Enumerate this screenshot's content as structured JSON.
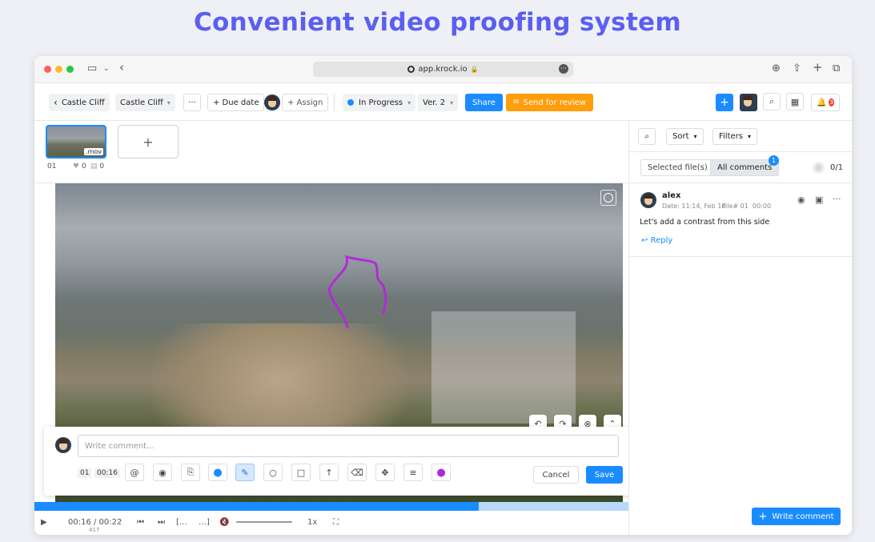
{
  "headline": "Convenient video proofing system",
  "browser": {
    "url": "app.krock.io"
  },
  "toolbar": {
    "back_label": "Castle Cliff",
    "project_label": "Castle Cliff",
    "more": "···",
    "due_date": "+ Due date",
    "assign": "+ Assign",
    "status": "In Progress",
    "version": "Ver. 2",
    "share": "Share",
    "send_review": "Send for review",
    "plus": "+",
    "notifications": "3"
  },
  "thumbs": {
    "ext": ".mov",
    "index": "01",
    "likes": "0",
    "comments": "0",
    "add": "+"
  },
  "composer": {
    "placeholder": "Write comment...",
    "frame": "01",
    "time": "00:16",
    "cancel": "Cancel",
    "save": "Save"
  },
  "player": {
    "time": "00:16 / 00:22",
    "frame": "417",
    "speed": "1x",
    "progress_fraction": 0.727
  },
  "sidebar": {
    "sort": "Sort",
    "filters": "Filters",
    "selected_files": "Selected file(s)",
    "all_comments": "All comments",
    "all_badge": "1",
    "resolved": "0/1",
    "comment": {
      "author": "alex",
      "date": "Date: 11:14, Feb 10",
      "file": "File# 01",
      "timecode": "00:00",
      "text": "Let's add a contrast from this side",
      "reply": "Reply"
    },
    "write_comment": "Write comment"
  },
  "colors": {
    "accent": "#1a8cff",
    "orange": "#ff9d0a",
    "headline": "#5b5ff0",
    "annotation": "#b12bd6"
  }
}
